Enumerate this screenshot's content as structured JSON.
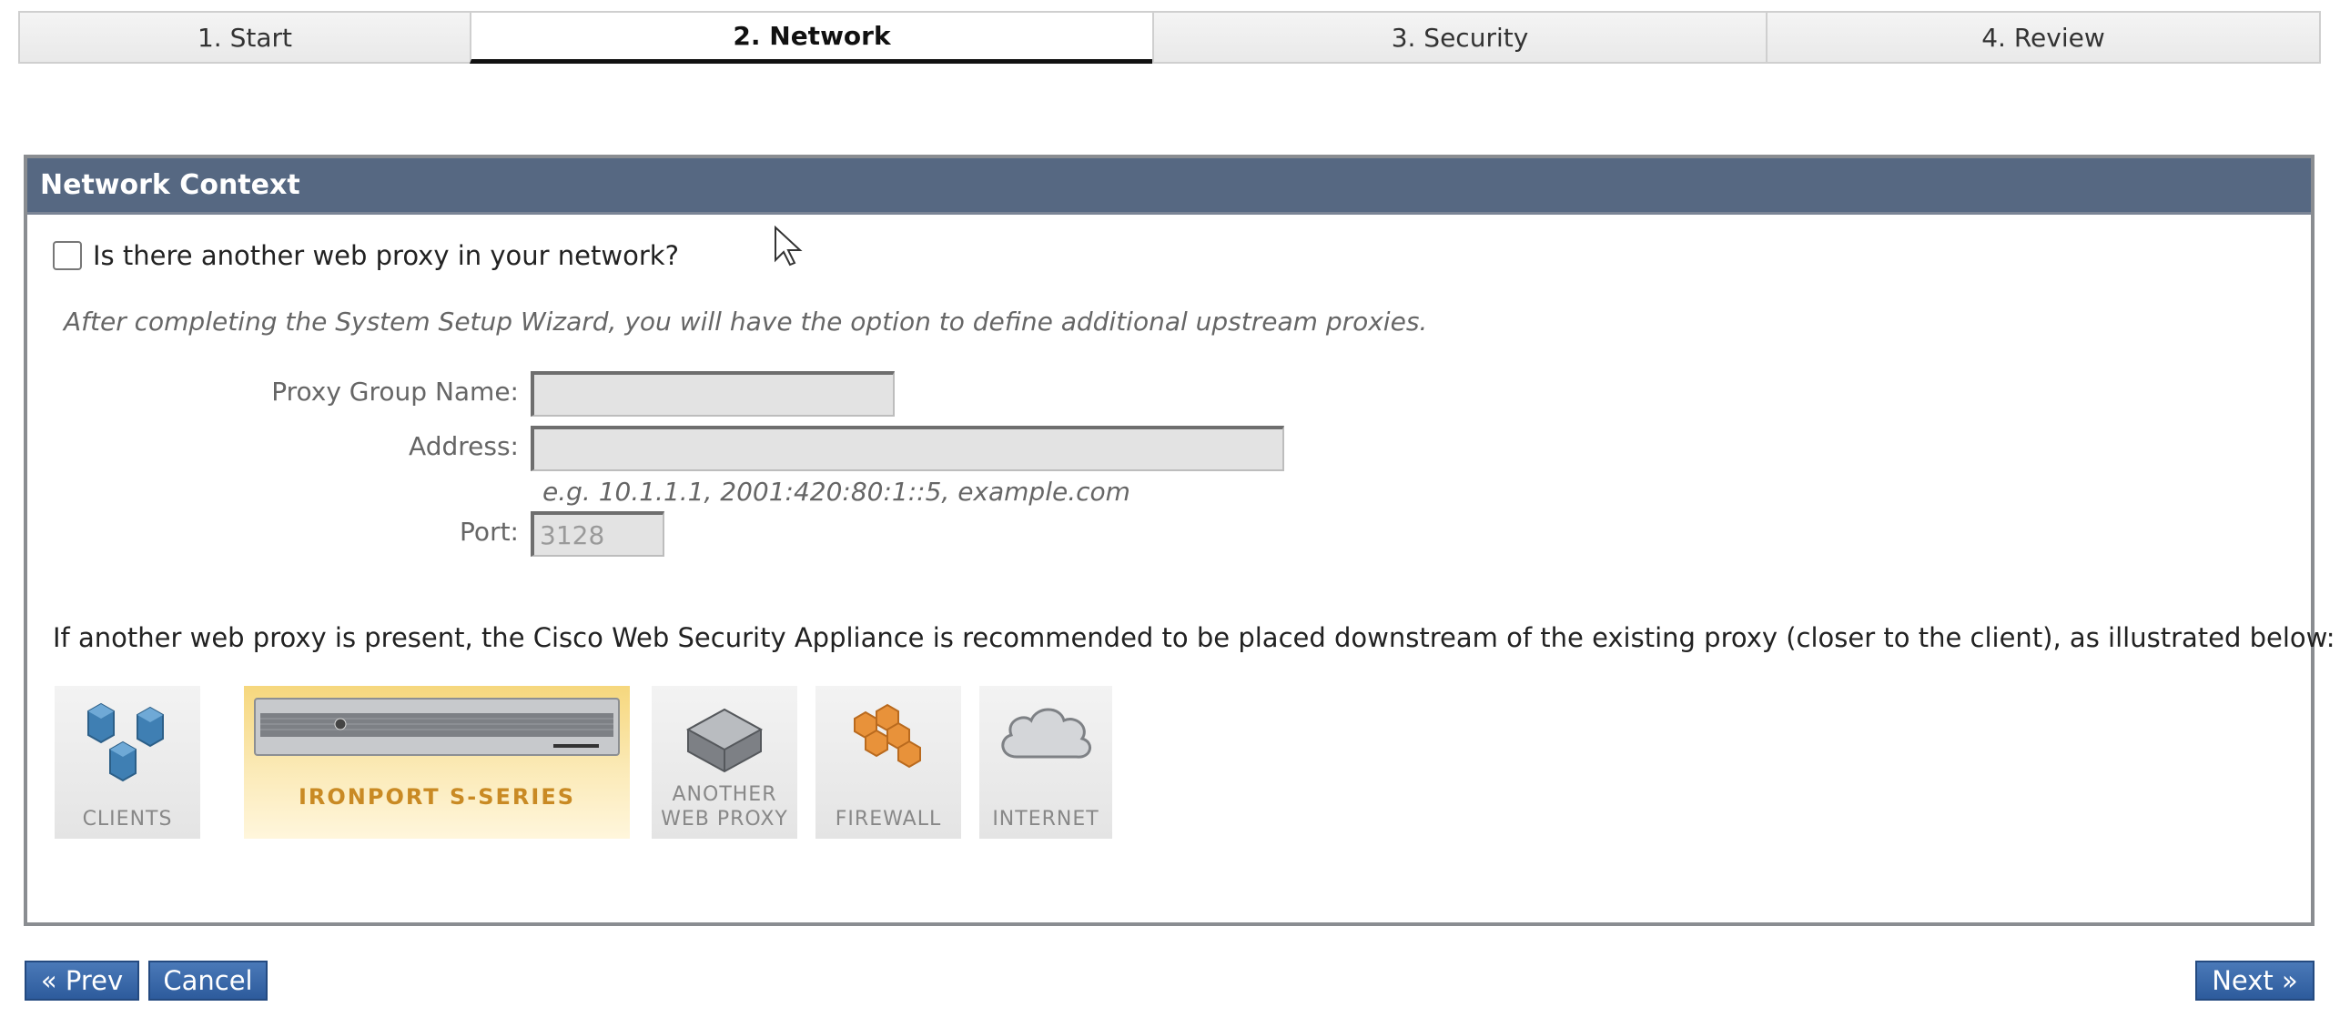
{
  "tabs": [
    {
      "label": "1. Start",
      "active": false
    },
    {
      "label": "2. Network",
      "active": true
    },
    {
      "label": "3. Security",
      "active": false
    },
    {
      "label": "4. Review",
      "active": false
    }
  ],
  "panel": {
    "title": "Network Context",
    "question": "Is there another web proxy in your network?",
    "question_checked": false,
    "hint": "After completing the System Setup Wizard, you will have the option to define additional upstream proxies.",
    "fields": {
      "proxy_group_name": {
        "label": "Proxy Group Name:",
        "value": ""
      },
      "address": {
        "label": "Address:",
        "value": "",
        "example": "e.g. 10.1.1.1, 2001:420:80:1::5, example.com"
      },
      "port": {
        "label": "Port:",
        "value": "3128"
      }
    },
    "info": "If another web proxy is present, the Cisco Web Security Appliance is recommended to be placed downstream of the existing proxy (closer to the client), as illustrated below:",
    "diagram": {
      "clients": "CLIENTS",
      "ironport": "IRONPORT S-SERIES",
      "another_line1": "ANOTHER",
      "another_line2": "WEB PROXY",
      "firewall": "FIREWALL",
      "internet": "INTERNET"
    }
  },
  "buttons": {
    "prev": "« Prev",
    "cancel": "Cancel",
    "next": "Next »"
  },
  "colors": {
    "panel_header": "#566882",
    "button": "#3a68aa",
    "ironport_tile": "#f6d77d"
  }
}
